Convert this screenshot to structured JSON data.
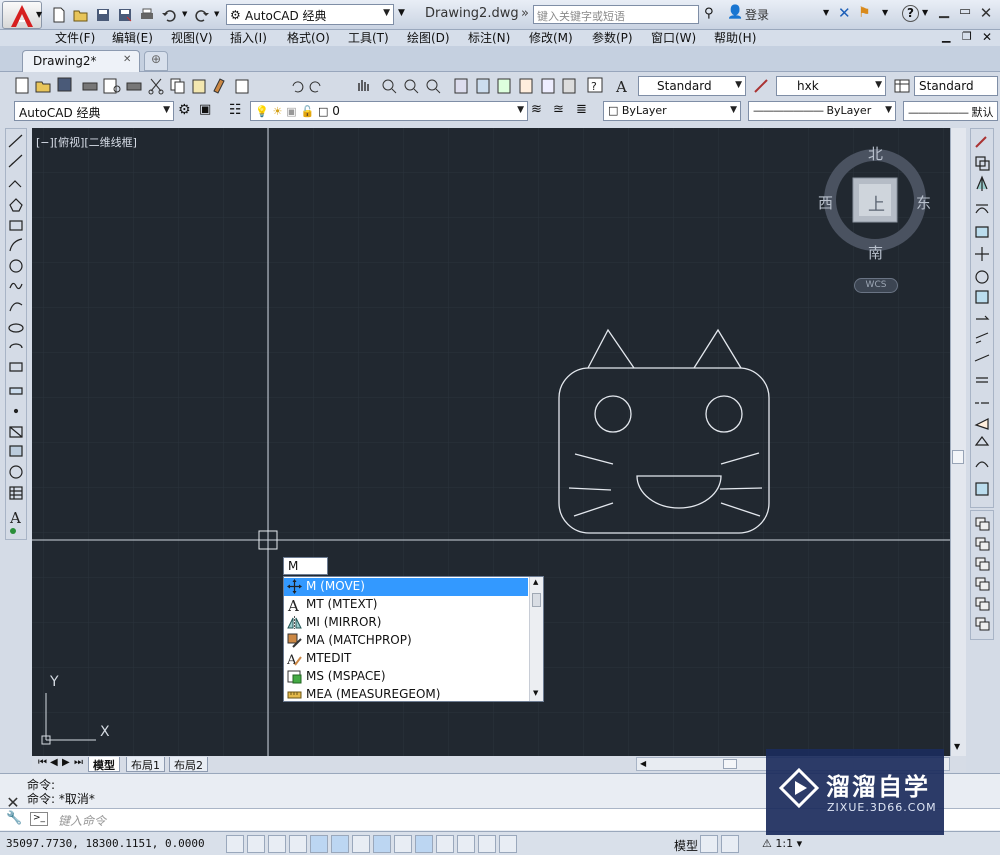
{
  "titlebar": {
    "workspace": "AutoCAD 经典",
    "document_title": "Drawing2.dwg",
    "search_placeholder": "键入关键字或短语",
    "login": "登录",
    "help": "?"
  },
  "menu": {
    "items": [
      "文件(F)",
      "编辑(E)",
      "视图(V)",
      "插入(I)",
      "格式(O)",
      "工具(T)",
      "绘图(D)",
      "标注(N)",
      "修改(M)",
      "参数(P)",
      "窗口(W)",
      "帮助(H)"
    ]
  },
  "tabs": {
    "doc_tab": "Drawing2*"
  },
  "toolbar1": {
    "text_style": "Standard",
    "dim_style": "hxk",
    "table_style": "Standard"
  },
  "toolbar2": {
    "workspace": "AutoCAD 经典",
    "layer": "0",
    "color": "ByLayer",
    "linetype": "ByLayer",
    "lineweight": "默认"
  },
  "viewport": {
    "label": "[−][俯视][二维线框]",
    "compass": {
      "north": "北",
      "south": "南",
      "east": "东",
      "west": "西",
      "top": "上"
    },
    "wcs": "WCS",
    "ucs_x": "X",
    "ucs_y": "Y"
  },
  "layout_tabs": [
    "模型",
    "布局1",
    "布局2"
  ],
  "autocomplete": {
    "input": "M",
    "items": [
      {
        "label": "M (MOVE)",
        "icon": "move-icon",
        "selected": true
      },
      {
        "label": "MT (MTEXT)",
        "icon": "mtext-icon",
        "selected": false
      },
      {
        "label": "MI (MIRROR)",
        "icon": "mirror-icon",
        "selected": false
      },
      {
        "label": "MA (MATCHPROP)",
        "icon": "matchprop-icon",
        "selected": false
      },
      {
        "label": "MTEDIT",
        "icon": "mtedit-icon",
        "selected": false
      },
      {
        "label": "MS (MSPACE)",
        "icon": "mspace-icon",
        "selected": false
      },
      {
        "label": "MEA (MEASUREGEOM)",
        "icon": "measure-icon",
        "selected": false
      }
    ]
  },
  "command": {
    "line1": "命令:",
    "line2": "命令: *取消*",
    "placeholder": "键入命令"
  },
  "statusbar": {
    "coords": "35097.7730, 18300.1151, 0.0000",
    "model": "模型",
    "scale": "1:1"
  },
  "watermark": {
    "title": "溜溜自学",
    "url": "ZIXUE.3D66.COM"
  },
  "colors": {
    "canvas_bg": "#212830",
    "selection": "#3399ff",
    "watermark_bg": "#1b2b5c"
  }
}
